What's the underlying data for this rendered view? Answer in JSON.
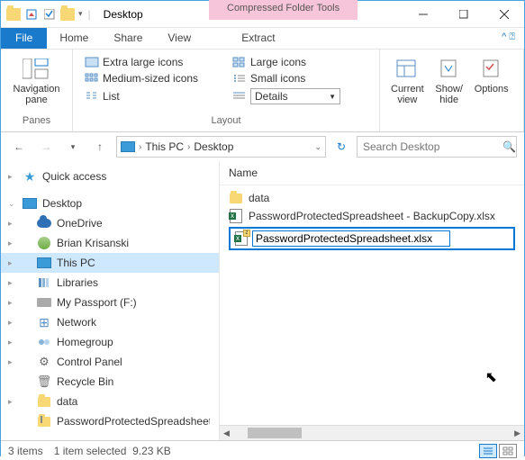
{
  "titlebar": {
    "title": "Desktop",
    "context_tab": "Compressed Folder Tools"
  },
  "tabs": {
    "file": "File",
    "home": "Home",
    "share": "Share",
    "view": "View",
    "extract": "Extract"
  },
  "ribbon": {
    "panes": {
      "label": "Navigation\npane",
      "group": "Panes"
    },
    "layout": {
      "extra_large": "Extra large icons",
      "large": "Large icons",
      "medium": "Medium-sized icons",
      "small": "Small icons",
      "list": "List",
      "details": "Details",
      "group": "Layout"
    },
    "view": {
      "current": "Current\nview",
      "showhide": "Show/\nhide",
      "options": "Options"
    }
  },
  "address": {
    "this_pc": "This PC",
    "desktop": "Desktop",
    "search_placeholder": "Search Desktop"
  },
  "nav": {
    "quick_access": "Quick access",
    "desktop": "Desktop",
    "onedrive": "OneDrive",
    "user": "Brian Krisanski",
    "this_pc": "This PC",
    "libraries": "Libraries",
    "passport": "My Passport (F:)",
    "network": "Network",
    "homegroup": "Homegroup",
    "control_panel": "Control Panel",
    "recycle_bin": "Recycle Bin",
    "data": "data",
    "zip": "PasswordProtectedSpreadsheet.zip"
  },
  "content": {
    "col_name": "Name",
    "folder_data": "data",
    "backup": "PasswordProtectedSpreadsheet - BackupCopy.xlsx",
    "rename_value": "PasswordProtectedSpreadsheet.xlsx"
  },
  "status": {
    "count": "3 items",
    "selected": "1 item selected",
    "size": "9.23 KB"
  }
}
